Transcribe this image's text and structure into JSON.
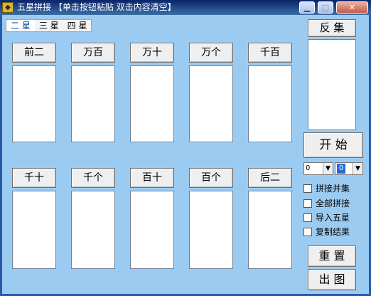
{
  "window": {
    "title": "五星拼接 【单击按钮粘贴 双击内容清空】",
    "minimize": "▁",
    "maximize": "□",
    "close": "✕"
  },
  "tabs": [
    "二 星",
    "三 星",
    "四 星"
  ],
  "panels": {
    "row1": [
      "前二",
      "万百",
      "万十",
      "万个",
      "千百"
    ],
    "row2": [
      "千十",
      "千个",
      "百十",
      "百个",
      "后二"
    ]
  },
  "side": {
    "reverse_button": "反 集",
    "start_button": "开 始",
    "combo1_value": "0",
    "combo2_value": "0",
    "combo_arrow": "▼",
    "options": [
      "拼接并集",
      "全部拼接",
      "导入五星",
      "复制结果"
    ],
    "reset_button": "重 置",
    "output_button": "出 图"
  }
}
